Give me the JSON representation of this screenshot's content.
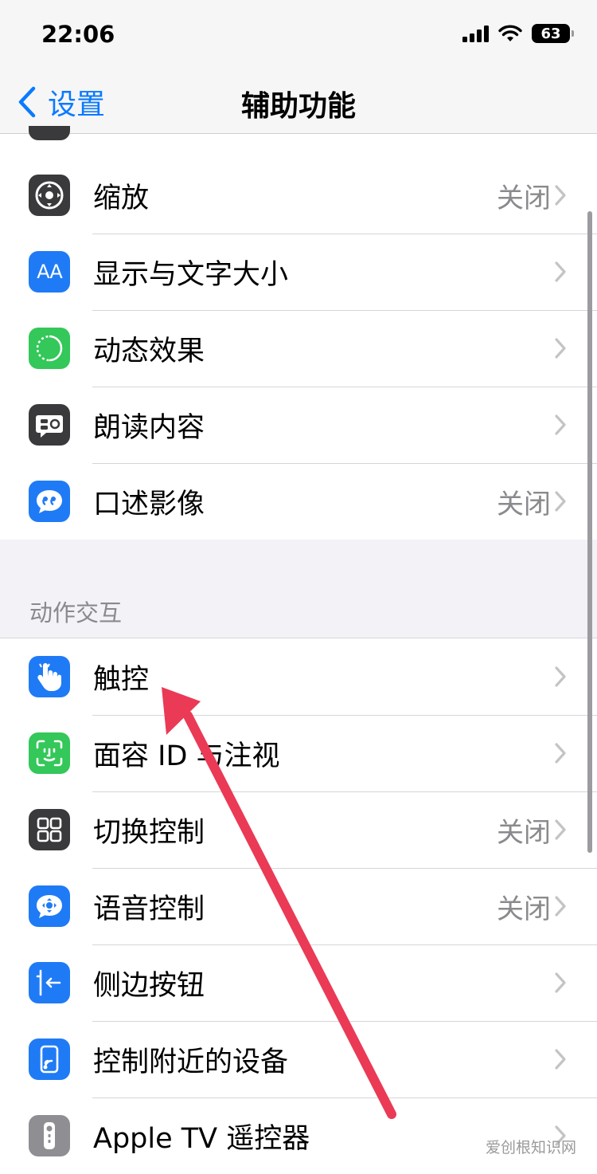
{
  "status_bar": {
    "time": "22:06",
    "battery": "63"
  },
  "nav": {
    "back_label": "设置",
    "title": "辅助功能"
  },
  "vision_items": [
    {
      "label": "缩放",
      "value": "关闭",
      "icon": "zoom-icon",
      "color": "#3a3a3c"
    },
    {
      "label": "显示与文字大小",
      "value": "",
      "icon": "text-size-icon",
      "color": "#1f7bf5"
    },
    {
      "label": "动态效果",
      "value": "",
      "icon": "motion-icon",
      "color": "#34c759"
    },
    {
      "label": "朗读内容",
      "value": "",
      "icon": "spoken-content-icon",
      "color": "#3a3a3c"
    },
    {
      "label": "口述影像",
      "value": "关闭",
      "icon": "audio-description-icon",
      "color": "#1f7bf5"
    }
  ],
  "section_header": "动作交互",
  "interaction_items": [
    {
      "label": "触控",
      "value": "",
      "icon": "touch-icon",
      "color": "#1f7bf5"
    },
    {
      "label": "面容 ID 与注视",
      "value": "",
      "icon": "face-id-icon",
      "color": "#34c759"
    },
    {
      "label": "切换控制",
      "value": "关闭",
      "icon": "switch-control-icon",
      "color": "#3a3a3c"
    },
    {
      "label": "语音控制",
      "value": "关闭",
      "icon": "voice-control-icon",
      "color": "#1f7bf5"
    },
    {
      "label": "侧边按钮",
      "value": "",
      "icon": "side-button-icon",
      "color": "#1f7bf5"
    },
    {
      "label": "控制附近的设备",
      "value": "",
      "icon": "nearby-devices-icon",
      "color": "#1f7bf5"
    },
    {
      "label": "Apple TV 遥控器",
      "value": "",
      "icon": "apple-tv-remote-icon",
      "color": "#8e8e93"
    }
  ],
  "watermark": "爱创根知识网",
  "colors": {
    "accent": "#0a7aff",
    "annotation_arrow": "#ea3a55",
    "group_background": "#f2f2f7"
  }
}
